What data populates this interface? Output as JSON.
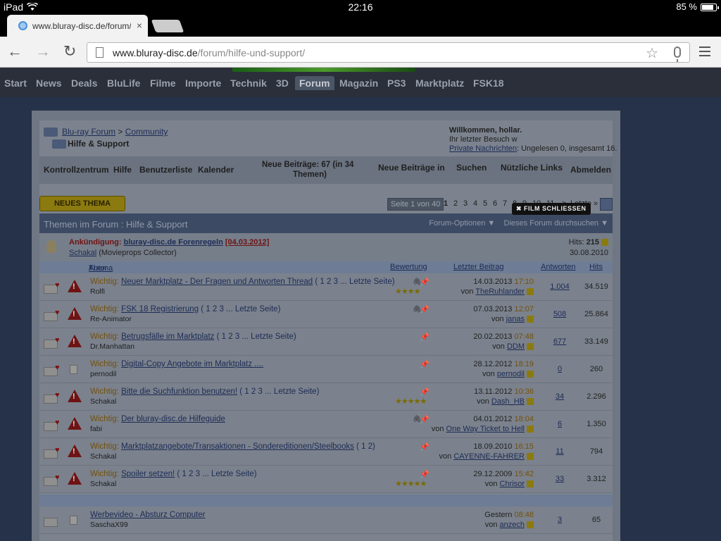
{
  "status_bar": {
    "device": "iPad",
    "time": "22:16",
    "battery": "85 %"
  },
  "tab": {
    "title": "www.bluray-disc.de/forum/",
    "close": "×"
  },
  "toolbar": {
    "back": "←",
    "forward": "→",
    "reload": "↻",
    "url_host": "www.bluray-disc.de",
    "url_path": "/forum/hilfe-und-support/",
    "star": "☆"
  },
  "sitenav": [
    "Start",
    "News",
    "Deals",
    "BluLife",
    "Filme",
    "Importe",
    "Technik",
    "3D",
    "Forum",
    "Magazin",
    "PS3",
    "Marktplatz",
    "FSK18"
  ],
  "breadcrumb": {
    "root": "Blu-ray Forum",
    "sep": ">",
    "parent": "Community",
    "current": "Hilfe & Support"
  },
  "welcome": {
    "line1": "Willkommen, hollar.",
    "line2": "Ihr letzter Besuch w",
    "pm_link": "Private Nachrichten",
    "pm_rest": ": Ungelesen 0, insgesamt 16."
  },
  "film_button": "✖ FILM SCHLIESSEN",
  "controls": {
    "kontrollzentrum": "Kontrollzentrum",
    "hilfe": "Hilfe",
    "benutzerliste": "Benutzerliste",
    "kalender": "Kalender",
    "neue_beitraege_1": "Neue Beiträge: 67 (in 34",
    "neue_beitraege_2": "Themen)",
    "neue_beitraege_in": "Neue Beiträge in",
    "suchen": "Suchen",
    "nuetzliche_links": "Nützliche Links",
    "abmelden": "Abmelden"
  },
  "new_thread_button": "NEUES THEMA",
  "pager": {
    "label": "Seite 1 von 40",
    "pages": [
      "1",
      "2",
      "3",
      "4",
      "5",
      "6",
      "7",
      "8",
      "9",
      "10",
      "11"
    ],
    "next": ">",
    "last": "Letzte »"
  },
  "thread_bar": {
    "title_prefix": "Themen im Forum",
    "title_sep": " : ",
    "title_forum": "Hilfe & Support",
    "options": "Forum-Optionen ▼",
    "search": "Dieses Forum durchsuchen ▼"
  },
  "announcement": {
    "label": "Ankündigung:",
    "title": "bluray-disc.de Forenregeln",
    "date": "[04.03.2012]",
    "author": "Schakal",
    "author_title": "(Movieprops Collector)",
    "hits_label": "Hits:",
    "hits": "215",
    "last_date": "30.08.2010"
  },
  "columns": {
    "thema": "Thema",
    "sep": " / ",
    "autor": "Autor",
    "bewertung": "Bewertung",
    "letzter": "Letzter Beitrag",
    "antworten": "Antworten",
    "hits": "Hits"
  },
  "threads": [
    {
      "prefix": "Wichtig:",
      "title": "Neuer Marktplatz - Der Fragen und Antworten Thread",
      "pages": "( 1 2 3 ... Letzte Seite)",
      "author": "Rolfi",
      "date": "14.03.2013",
      "time": "17:10",
      "by": "von",
      "user": "TheRuhlander",
      "replies": "1.004",
      "hits": "34.519",
      "stars": "★★★★"
    },
    {
      "prefix": "Wichtig:",
      "title": "FSK 18 Registrierung",
      "pages": "( 1 2 3 ... Letzte Seite)",
      "author": "Re-Animator",
      "date": "07.03.2013",
      "time": "12:07",
      "by": "von",
      "user": "janas",
      "replies": "508",
      "hits": "25.864",
      "stars": ""
    },
    {
      "prefix": "Wichtig:",
      "title": "Betrugsfälle im Marktplatz",
      "pages": "( 1 2 3 ... Letzte Seite)",
      "author": "Dr.Manhattan",
      "date": "20.02.2013",
      "time": "07:48",
      "by": "von",
      "user": "DDM",
      "replies": "677",
      "hits": "33.149",
      "stars": ""
    },
    {
      "prefix": "Wichtig:",
      "title": "Digital-Copy Angebote im Marktplatz ....",
      "pages": "",
      "author": "pernodil",
      "date": "28.12.2012",
      "time": "18:19",
      "by": "von",
      "user": "pernodil",
      "replies": "0",
      "hits": "260",
      "stars": ""
    },
    {
      "prefix": "Wichtig:",
      "title": "Bitte die Suchfunktion benutzen!",
      "pages": "( 1 2 3 ... Letzte Seite)",
      "author": "Schakal",
      "date": "13.11.2012",
      "time": "10:36",
      "by": "von",
      "user": "Dash_HB",
      "replies": "34",
      "hits": "2.296",
      "stars": "★★★★★"
    },
    {
      "prefix": "Wichtig:",
      "title": "Der bluray-disc.de Hilfeguide",
      "pages": "",
      "author": "fabi",
      "date": "04.01.2012",
      "time": "18:04",
      "by": "von",
      "user": "One Way Ticket to Hell",
      "replies": "6",
      "hits": "1.350",
      "stars": ""
    },
    {
      "prefix": "Wichtig:",
      "title": "Marktplatzangebote/Transaktionen - Sondereditionen/Steelbooks",
      "pages": "( 1 2)",
      "author": "Schakal",
      "date": "18.09.2010",
      "time": "16:15",
      "by": "von",
      "user": "CAYENNE-FAHRER",
      "replies": "11",
      "hits": "794",
      "stars": ""
    },
    {
      "prefix": "Wichtig:",
      "title": "Spoiler setzen!",
      "pages": "( 1 2 3 ... Letzte Seite)",
      "author": "Schakal",
      "date": "29.12.2009",
      "time": "15:42",
      "by": "von",
      "user": "Chrisor",
      "replies": "33",
      "hits": "3.312",
      "stars": "★★★★★"
    }
  ],
  "normal_thread": {
    "title": "Werbevideo - Absturz Computer",
    "author": "SaschaX99",
    "date": "Gestern",
    "time": "08:48",
    "by": "von",
    "user": "anzech",
    "replies": "3",
    "hits": "65"
  },
  "colors": {
    "page_bg": "#25324a",
    "accent_gold": "#8b7a10",
    "header_bar": "#3d4a63"
  }
}
